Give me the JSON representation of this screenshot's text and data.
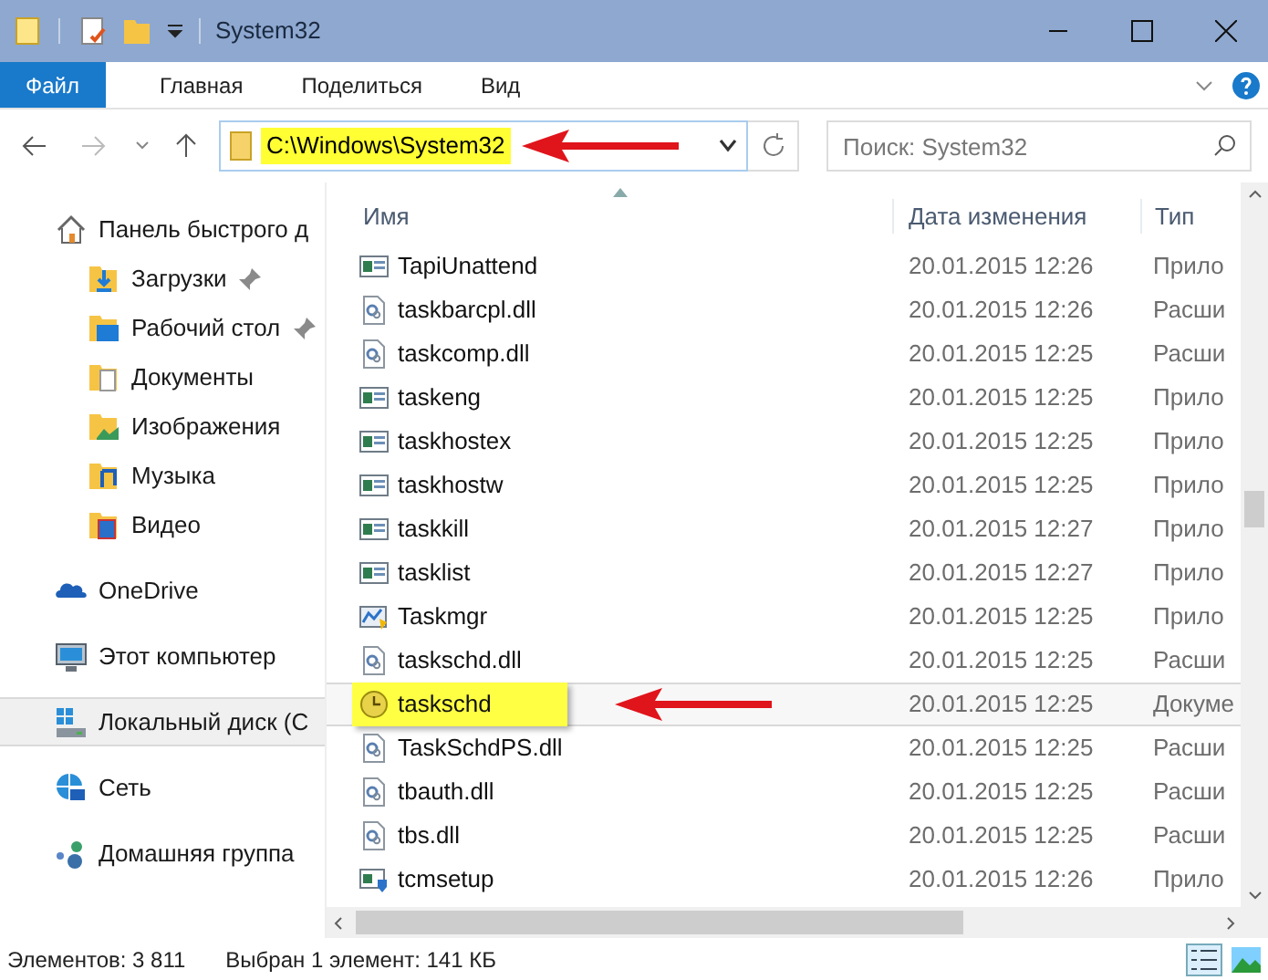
{
  "window": {
    "title": "System32"
  },
  "ribbon_tabs": [
    {
      "label": "Файл",
      "selected": true
    },
    {
      "label": "Главная",
      "selected": false
    },
    {
      "label": "Поделиться",
      "selected": false
    },
    {
      "label": "Вид",
      "selected": false
    }
  ],
  "address": {
    "path": "C:\\Windows\\System32",
    "highlighted": true
  },
  "search": {
    "placeholder": "Поиск: System32"
  },
  "nav": [
    {
      "label": "Панель быстрого д",
      "kind": "home",
      "selected": false,
      "children": [
        {
          "label": "Загрузки",
          "kind": "downloads",
          "pinned": true,
          "selected": false
        },
        {
          "label": "Рабочий стол",
          "kind": "desktop",
          "pinned": true,
          "selected": false
        },
        {
          "label": "Документы",
          "kind": "documents",
          "pinned": false,
          "selected": false
        },
        {
          "label": "Изображения",
          "kind": "images",
          "pinned": false,
          "selected": false
        },
        {
          "label": "Музыка",
          "kind": "music",
          "pinned": false,
          "selected": false
        },
        {
          "label": "Видео",
          "kind": "video",
          "pinned": false,
          "selected": false
        }
      ]
    },
    {
      "label": "OneDrive",
      "kind": "cloud",
      "selected": false
    },
    {
      "label": "Этот компьютер",
      "kind": "computer",
      "selected": false
    },
    {
      "label": "Локальный диск (C",
      "kind": "disk",
      "selected": true
    },
    {
      "label": "Сеть",
      "kind": "network",
      "selected": false
    },
    {
      "label": "Домашняя группа",
      "kind": "homegroup",
      "selected": false
    }
  ],
  "table": {
    "columns": [
      "Имя",
      "Дата изменения",
      "Тип"
    ],
    "rows": [
      {
        "name": "TapiUnattend",
        "kind": "app",
        "date": "20.01.2015 12:26",
        "type": "Прило",
        "selected": false,
        "highlighted": false
      },
      {
        "name": "taskbarcpl.dll",
        "kind": "dll",
        "date": "20.01.2015 12:26",
        "type": "Расши",
        "selected": false,
        "highlighted": false
      },
      {
        "name": "taskcomp.dll",
        "kind": "dll",
        "date": "20.01.2015 12:25",
        "type": "Расши",
        "selected": false,
        "highlighted": false
      },
      {
        "name": "taskeng",
        "kind": "app",
        "date": "20.01.2015 12:25",
        "type": "Прило",
        "selected": false,
        "highlighted": false
      },
      {
        "name": "taskhostex",
        "kind": "app",
        "date": "20.01.2015 12:25",
        "type": "Прило",
        "selected": false,
        "highlighted": false
      },
      {
        "name": "taskhostw",
        "kind": "app",
        "date": "20.01.2015 12:25",
        "type": "Прило",
        "selected": false,
        "highlighted": false
      },
      {
        "name": "taskkill",
        "kind": "app",
        "date": "20.01.2015 12:27",
        "type": "Прило",
        "selected": false,
        "highlighted": false
      },
      {
        "name": "tasklist",
        "kind": "app",
        "date": "20.01.2015 12:27",
        "type": "Прило",
        "selected": false,
        "highlighted": false
      },
      {
        "name": "Taskmgr",
        "kind": "taskmgr",
        "date": "20.01.2015 12:25",
        "type": "Прило",
        "selected": false,
        "highlighted": false
      },
      {
        "name": "taskschd.dll",
        "kind": "dll",
        "date": "20.01.2015 12:25",
        "type": "Расши",
        "selected": false,
        "highlighted": false
      },
      {
        "name": "taskschd",
        "kind": "clock",
        "date": "20.01.2015 12:25",
        "type": "Докуме",
        "selected": true,
        "highlighted": true
      },
      {
        "name": "TaskSchdPS.dll",
        "kind": "dll",
        "date": "20.01.2015 12:25",
        "type": "Расши",
        "selected": false,
        "highlighted": false
      },
      {
        "name": "tbauth.dll",
        "kind": "dll",
        "date": "20.01.2015 12:25",
        "type": "Расши",
        "selected": false,
        "highlighted": false
      },
      {
        "name": "tbs.dll",
        "kind": "dll",
        "date": "20.01.2015 12:25",
        "type": "Расши",
        "selected": false,
        "highlighted": false
      },
      {
        "name": "tcmsetup",
        "kind": "setup",
        "date": "20.01.2015 12:26",
        "type": "Прило",
        "selected": false,
        "highlighted": false
      }
    ]
  },
  "status_bar": {
    "item_count": "Элементов: 3 811",
    "selection": "Выбран 1 элемент: 141 КБ"
  }
}
